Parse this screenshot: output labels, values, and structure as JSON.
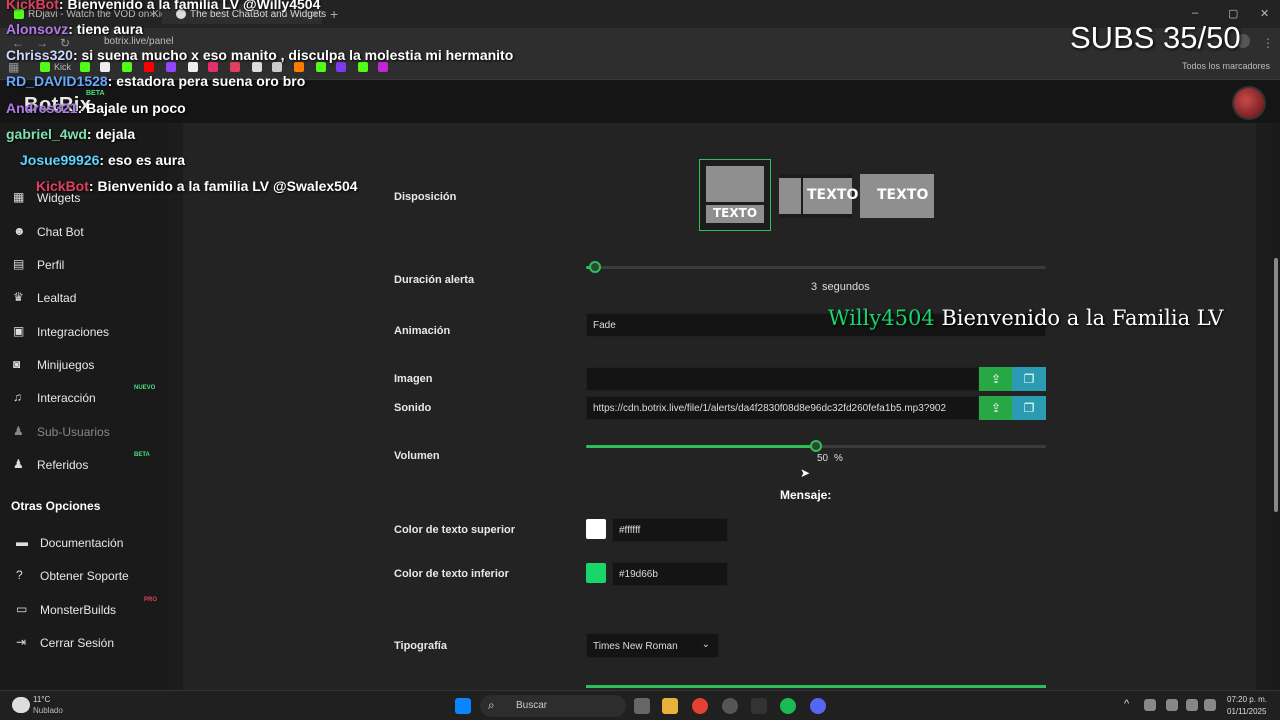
{
  "browser": {
    "tabs": [
      {
        "label": "RDjavi - Watch the VOD on Kick"
      },
      {
        "label": "The best ChatBot and Widgets"
      }
    ],
    "new_tab": "+",
    "url": "botrix.live/panel",
    "bookmarks_label": "Todos los marcadores",
    "bookmark_kick": "Kick",
    "window_controls": [
      "–",
      "▢",
      "✕"
    ]
  },
  "app": {
    "logo": "BotRix",
    "logo_badge": "BETA"
  },
  "sidebar": {
    "items": [
      {
        "label": "Widgets",
        "icon": "grid-icon"
      },
      {
        "label": "Chat Bot",
        "icon": "robot-icon"
      },
      {
        "label": "Perfil",
        "icon": "id-card-icon"
      },
      {
        "label": "Lealtad",
        "icon": "trophy-icon"
      },
      {
        "label": "Integraciones",
        "icon": "plug-icon"
      },
      {
        "label": "Minijuegos",
        "icon": "gamepad-icon"
      },
      {
        "label": "Interacción",
        "icon": "music-icon",
        "badge": "NUEVO"
      },
      {
        "label": "Sub-Usuarios",
        "icon": "users-icon",
        "disabled": true
      },
      {
        "label": "Referidos",
        "icon": "users-icon",
        "badge": "BETA"
      }
    ],
    "other_title": "Otras Opciones",
    "other_items": [
      {
        "label": "Documentación",
        "icon": "book-icon"
      },
      {
        "label": "Obtener Soporte",
        "icon": "question-icon"
      },
      {
        "label": "MonsterBuilds",
        "icon": "laptop-icon",
        "badge": "PRO"
      },
      {
        "label": "Cerrar Sesión",
        "icon": "logout-icon"
      }
    ]
  },
  "form": {
    "layout_label": "Disposición",
    "layout_options": [
      "TEXTO",
      "TEXTO",
      "TEXTO"
    ],
    "duration_label": "Duración alerta",
    "duration_value": "3",
    "duration_unit": "segundos",
    "duration_fraction": 0.02,
    "animation_label": "Animación",
    "animation_value": "Fade",
    "image_label": "Imagen",
    "image_value": "",
    "sound_label": "Sonido",
    "sound_value": "https://cdn.botrix.live/file/1/alerts/da4f2830f08d8e96dc32fd260fefa1b5.mp3?902",
    "volume_label": "Volumen",
    "volume_value": "50",
    "volume_unit": "%",
    "volume_fraction": 0.5,
    "message_title": "Mensaje:",
    "top_color_label": "Color de texto superior",
    "top_color_value": "#ffffff",
    "bottom_color_label": "Color de texto inferior",
    "bottom_color_value": "#19d66b",
    "font_label": "Tipografía",
    "font_value": "Times New Roman"
  },
  "overlay": {
    "subs": "SUBS 35/50",
    "alert_user": "Willy4504",
    "alert_text": "Bienvenido a la Familia LV",
    "alert_user_color": "#19d66b",
    "chat": [
      {
        "user": "KickBot",
        "text": ": Bienvenido a la familia LV @Willy4504",
        "color": "#e0405e"
      },
      {
        "user": "Alonsovz",
        "text": ": tiene aura",
        "color": "#b07be8"
      },
      {
        "user": "Chriss320",
        "text": ": si suena mucho x eso manito , disculpa la molestia mi hermanito",
        "color": "#cfd8ff"
      },
      {
        "user": "RD_DAVID1528",
        "text": ": estadora pera suena oro bro",
        "color": "#6aa8ff"
      },
      {
        "user": "Andres321",
        "text": ": Bajale un poco",
        "color": "#b07be8"
      },
      {
        "user": "gabriel_4wd",
        "text": ": dejala",
        "color": "#7fe0b0"
      },
      {
        "user": "Josue99926",
        "text": ": eso es aura",
        "color": "#5fd3ff"
      },
      {
        "user": "KickBot",
        "text": ": Bienvenido a la familia LV @Swalex504",
        "color": "#e0405e"
      }
    ]
  },
  "taskbar": {
    "weather_temp": "11°C",
    "weather_desc": "Nublado",
    "search_placeholder": "Buscar",
    "time": "07:20 p. m.",
    "date": "01/11/2025"
  },
  "colors": {
    "accent": "#2fbf57",
    "background": "#232323",
    "sidebar": "#1a1a1a"
  }
}
